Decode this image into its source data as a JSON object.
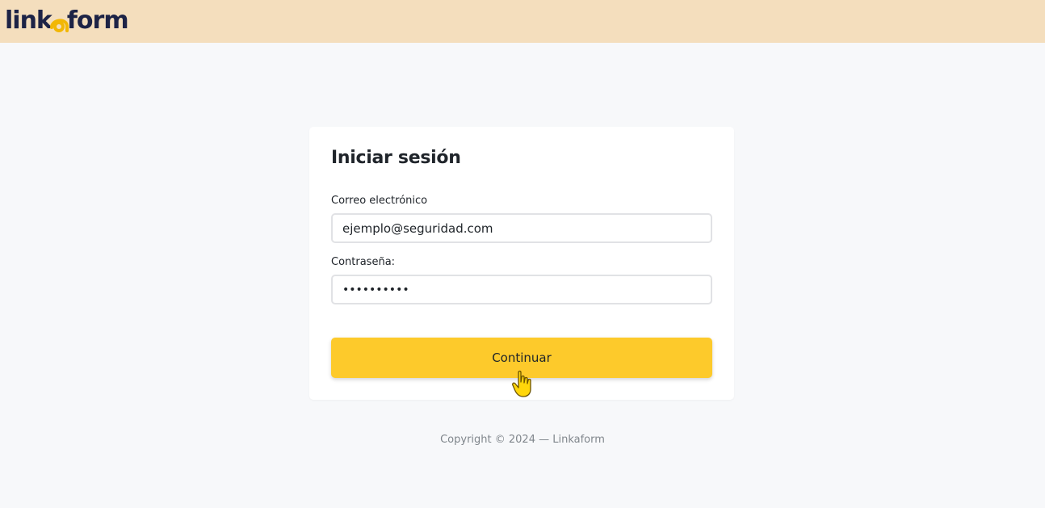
{
  "header": {
    "logo": {
      "part1": "link",
      "part2": "form",
      "mark_color": "#f2b705",
      "text_color": "#1d2346"
    },
    "background": "#f4debd"
  },
  "login": {
    "title": "Iniciar sesión",
    "email_label": "Correo electrónico",
    "email_value": "ejemplo@seguridad.com",
    "password_label": "Contraseña:",
    "password_value": "••••••••••",
    "submit_label": "Continuar",
    "submit_color": "#fdca2b"
  },
  "footer": {
    "copyright": "Copyright © 2024 — Linkaform"
  },
  "cursor": {
    "icon": "hand-pointer-icon"
  }
}
